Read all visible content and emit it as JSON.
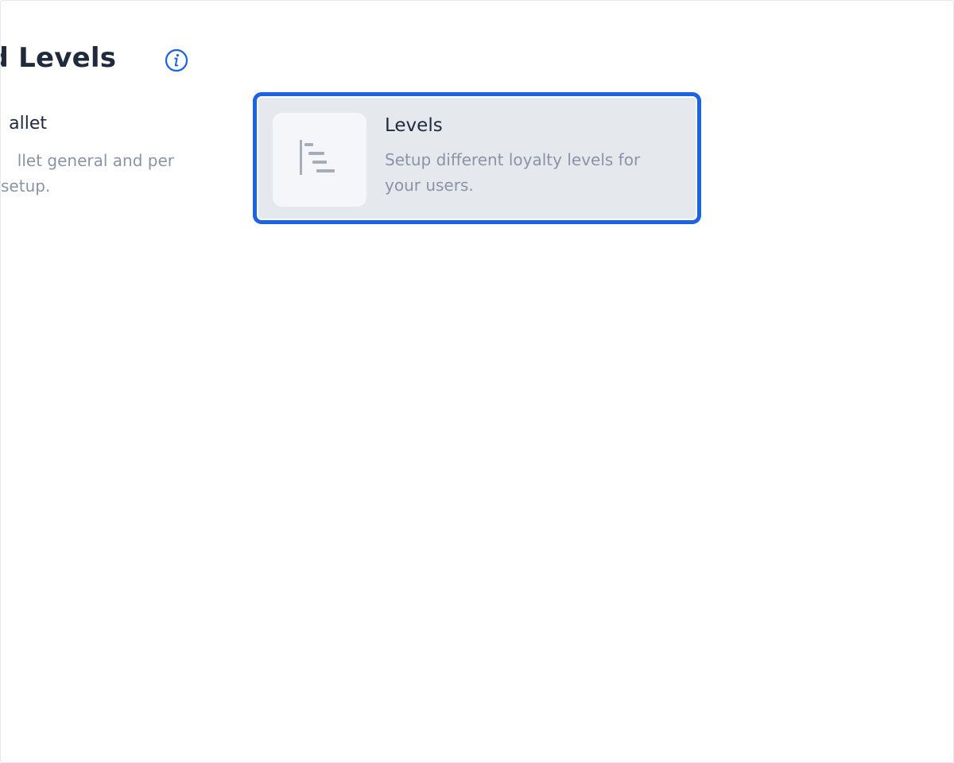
{
  "header": {
    "title": "and Levels",
    "info_icon": "info-circle-icon"
  },
  "cards": {
    "wallet": {
      "title": "allet",
      "description_line1": "llet general and per",
      "description_line2": "setup."
    },
    "levels": {
      "title": "Levels",
      "description": "Setup different loyalty levels for your users.",
      "icon": "levels-bars-icon"
    }
  },
  "colors": {
    "accent": "#1b62e5",
    "title_text": "#1f2a3d",
    "muted_text": "#8a94a6",
    "card_selected_bg": "#e5e8ed",
    "icon_tile_bg": "#f4f6f9",
    "icon_stroke": "#a6adba"
  }
}
